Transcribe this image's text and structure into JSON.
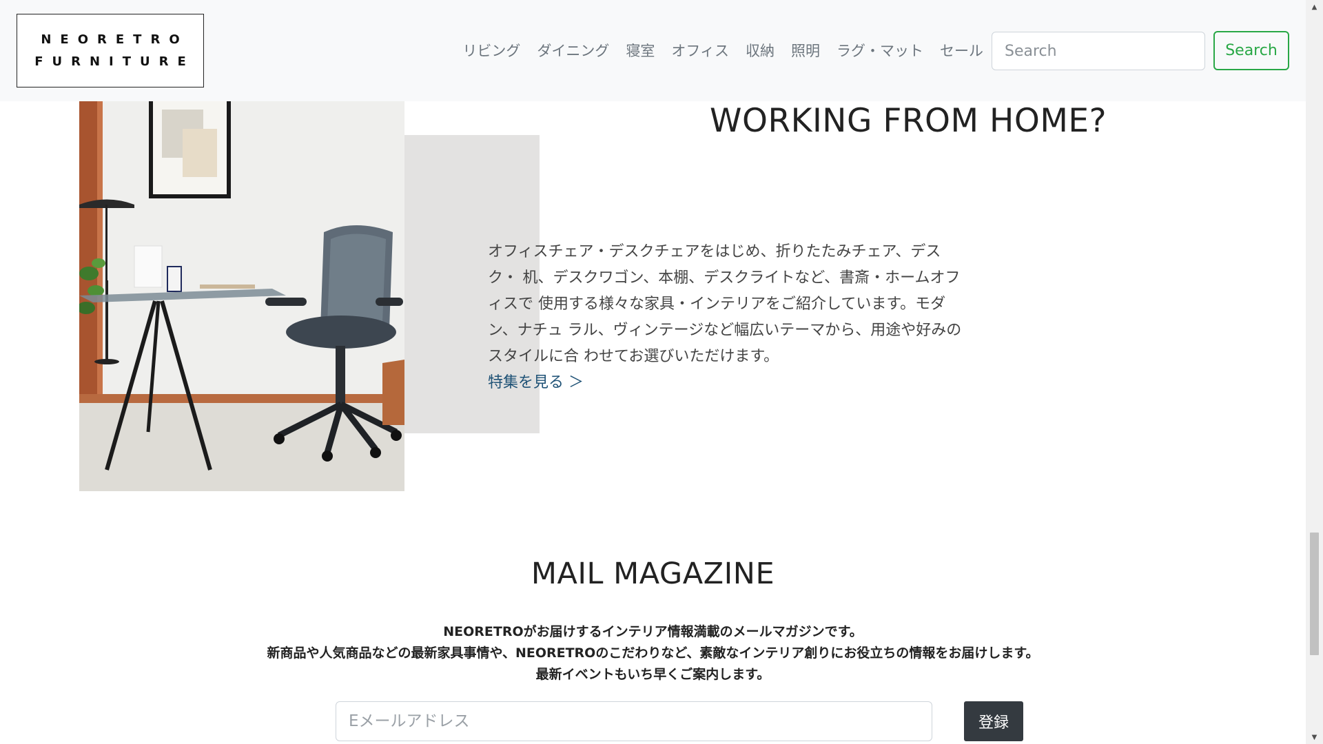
{
  "header": {
    "logo_line1": "NEORETRO",
    "logo_line2": "FURNITURE",
    "nav": [
      "リビング",
      "ダイニング",
      "寝室",
      "オフィス",
      "収納",
      "照明",
      "ラグ・マット",
      "セール"
    ],
    "search_placeholder": "Search",
    "search_button": "Search"
  },
  "feature": {
    "title": "WORKING FROM HOME?",
    "description": "オフィスチェア・デスクチェアをはじめ、折りたたみチェア、デスク・ 机、デスクワゴン、本棚、デスクライトなど、書斎・ホームオフィスで 使用する様々な家具・インテリアをご紹介しています。モダン、ナチュ ラル、ヴィンテージなど幅広いテーマから、用途や好みのスタイルに合 わせてお選びいただけます。",
    "link": "特集を見る ＞",
    "image_alt": "office-desk-and-chair-photo"
  },
  "mail_magazine": {
    "title": "MAIL MAGAZINE",
    "lines": [
      "NEORETROがお届けするインテリア情報満載のメールマガジンです。",
      "新商品や人気商品などの最新家具事情や、NEORETROのこだわりなど、素敵なインテリア創りにお役立ちの情報をお届けします。",
      "最新イベントもいち早くご案内します。"
    ],
    "email_placeholder": "Eメールアドレス",
    "register_button": "登録"
  },
  "colors": {
    "accent_green": "#28a745",
    "dark_button": "#343a40",
    "link_blue": "#1f5276",
    "navbar_bg": "#f8f9fa",
    "feature_gray": "#e3e2e1"
  },
  "scroll": {
    "position_fraction": 0.85
  }
}
